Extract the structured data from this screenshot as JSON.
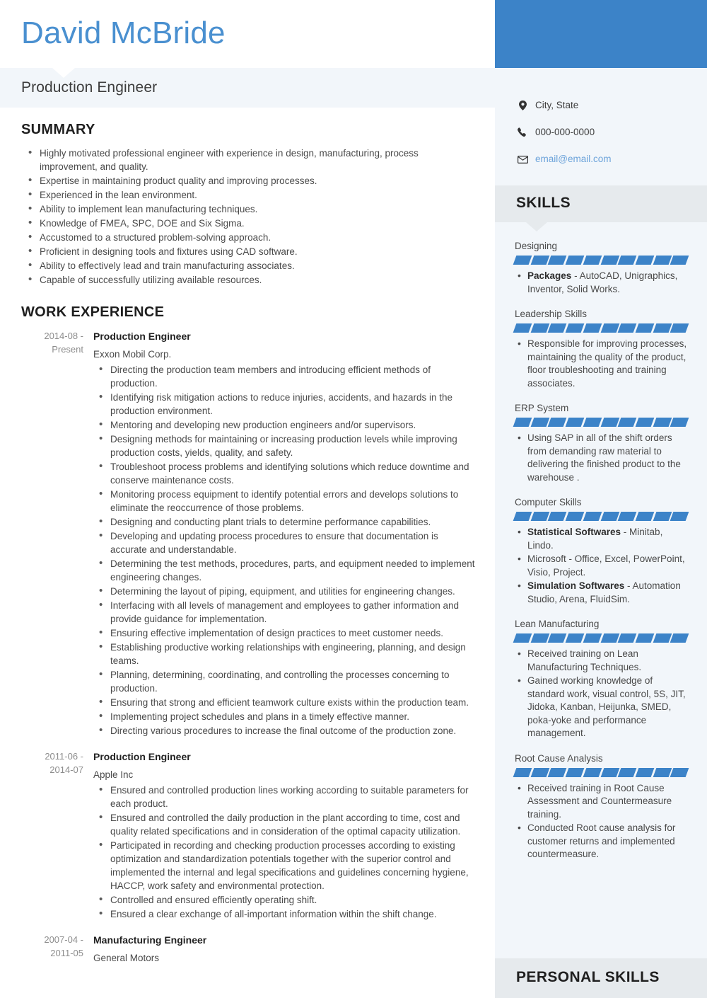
{
  "header": {
    "name": "David McBride",
    "job_title": "Production Engineer",
    "accent_color": "#3c83c8",
    "name_color": "#4a90d0"
  },
  "contacts": [
    {
      "icon": "location-pin-icon",
      "text": "City, State",
      "is_link": false
    },
    {
      "icon": "phone-icon",
      "text": "000-000-0000",
      "is_link": false
    },
    {
      "icon": "envelope-icon",
      "text": "email@email.com",
      "is_link": true
    }
  ],
  "summary": {
    "title": "SUMMARY",
    "items": [
      "Highly motivated professional engineer with experience in design, manufacturing, process improvement, and quality.",
      "Expertise in maintaining product quality and improving processes.",
      "Experienced in the lean environment.",
      "Ability to implement lean manufacturing techniques.",
      "Knowledge of FMEA, SPC, DOE and Six Sigma.",
      "Accustomed to a structured problem-solving approach.",
      "Proficient in designing tools and fixtures using CAD software.",
      "Ability to effectively lead and train manufacturing associates.",
      "Capable of successfully utilizing available resources."
    ]
  },
  "work_experience": {
    "title": "WORK EXPERIENCE",
    "entries": [
      {
        "dates": "2014-08 - Present",
        "role": "Production Engineer",
        "org": "Exxon Mobil Corp.",
        "bullets": [
          "Directing the production team members and introducing efficient methods of production.",
          "Identifying risk mitigation actions to reduce injuries, accidents, and hazards in the production environment.",
          "Mentoring and developing new production engineers and/or supervisors.",
          "Designing methods for maintaining or increasing production levels while improving production costs, yields, quality, and safety.",
          "Troubleshoot process problems and identifying solutions which reduce downtime and conserve maintenance costs.",
          "Monitoring process equipment to identify potential errors and develops solutions to eliminate the reoccurrence of those problems.",
          "Designing and conducting plant trials to determine performance capabilities.",
          "Developing and updating process procedures to ensure that documentation is accurate and understandable.",
          "Determining the test methods, procedures, parts, and equipment needed to implement engineering changes.",
          "Determining the layout of piping, equipment, and utilities for engineering changes.",
          "Interfacing with all levels of management and employees to gather information and provide guidance for implementation.",
          "Ensuring effective implementation of design practices to meet customer needs.",
          "Establishing productive working relationships with engineering, planning, and design teams.",
          "Planning, determining, coordinating, and controlling the processes concerning to production.",
          "Ensuring that strong and efficient teamwork culture exists within the production team.",
          "Implementing project schedules and plans in a timely effective manner.",
          "Directing various procedures to increase the final outcome of the production zone."
        ]
      },
      {
        "dates": "2011-06 - 2014-07",
        "role": "Production Engineer",
        "org": "Apple Inc",
        "bullets": [
          "Ensured and controlled production lines working according to suitable parameters for each product.",
          "Ensured and controlled the daily production in the plant according to time, cost and quality related specifications and in consideration of the optimal capacity utilization.",
          "Participated in recording and checking production processes according to existing optimization and standardization potentials together with the superior control and implemented the internal and legal specifications and guidelines concerning hygiene, HACCP, work safety and environmental protection.",
          "Controlled and ensured efficiently operating shift.",
          "Ensured a clear exchange of all-important information within the shift change."
        ]
      },
      {
        "dates": "2007-04 - 2011-05",
        "role": "Manufacturing Engineer",
        "org": "General Motors",
        "bullets": []
      }
    ]
  },
  "skills": {
    "title": "SKILLS",
    "meter_segments": 10,
    "groups": [
      {
        "label": "Designing",
        "filled": 10,
        "items": [
          {
            "bold": "Packages",
            "rest": " - AutoCAD, Unigraphics, Inventor, Solid Works."
          }
        ]
      },
      {
        "label": "Leadership Skills",
        "filled": 10,
        "items": [
          {
            "bold": "",
            "rest": "Responsible for improving processes, maintaining the quality of the product, floor troubleshooting and training associates."
          }
        ]
      },
      {
        "label": "ERP System",
        "filled": 10,
        "items": [
          {
            "bold": "",
            "rest": "Using SAP in all of the shift orders from demanding raw material to delivering the finished product to the warehouse ."
          }
        ]
      },
      {
        "label": "Computer Skills",
        "filled": 10,
        "items": [
          {
            "bold": "Statistical Softwares",
            "rest": " - Minitab, Lindo."
          },
          {
            "bold": "",
            "rest": "Microsoft - Office, Excel, PowerPoint, Visio, Project."
          },
          {
            "bold": "Simulation Softwares",
            "rest": " - Automation Studio, Arena, FluidSim."
          }
        ]
      },
      {
        "label": "Lean Manufacturing",
        "filled": 10,
        "items": [
          {
            "bold": "",
            "rest": "Received training on Lean Manufacturing Techniques."
          },
          {
            "bold": "",
            "rest": "Gained working knowledge of standard work, visual control, 5S, JIT, Jidoka, Kanban, Heijunka, SMED, poka-yoke and performance management."
          }
        ]
      },
      {
        "label": "Root Cause Analysis",
        "filled": 10,
        "items": [
          {
            "bold": "",
            "rest": "Received training in Root Cause Assessment and Countermeasure training."
          },
          {
            "bold": "",
            "rest": "Conducted Root cause analysis for customer returns and implemented countermeasure."
          }
        ]
      }
    ]
  },
  "personal_skills": {
    "title": "PERSONAL SKILLS"
  }
}
